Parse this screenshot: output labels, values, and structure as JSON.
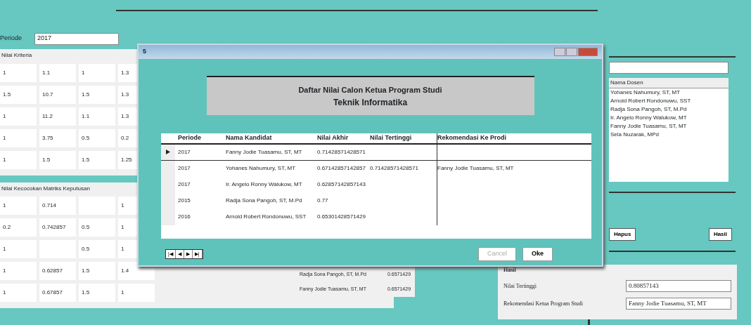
{
  "periode": {
    "label": "Periode",
    "value": "2017"
  },
  "criteria_group": {
    "title": "Nilai Kriteria",
    "rows": [
      [
        "1",
        "1.1",
        "1",
        "1.3"
      ],
      [
        "1.5",
        "10.7",
        "1.5",
        "1.3"
      ],
      [
        "1",
        "11.2",
        "1.1",
        "1.3"
      ],
      [
        "1",
        "3.75",
        "0.5",
        "0.2"
      ],
      [
        "1",
        "1.5",
        "1.5",
        "1.25"
      ]
    ]
  },
  "match_group": {
    "title": "Nilai Kecocokan Matriks Keputusan",
    "rows": [
      [
        "1",
        "0.714",
        "",
        "1"
      ],
      [
        "0.2",
        "0.742857",
        "0.5",
        "1"
      ],
      [
        "1",
        "",
        "0.5",
        "1"
      ],
      [
        "1",
        "0.62857",
        "1.5",
        "1.4"
      ],
      [
        "1",
        "0.67857",
        "1.5",
        "1"
      ]
    ]
  },
  "bottom_rows": [
    {
      "name": "Radja Sona Pangoh, ST, M.Pd",
      "value": "0.6571429"
    },
    {
      "name": "Fanny Jodie Tuasamu, ST, MT",
      "value": "0.6571429"
    }
  ],
  "lecturers": {
    "header": "Nama Dosen",
    "items": [
      "Yohanes Nahumury, ST, MT",
      "Arnold Robert Rondonuwu, SST",
      "Radja Sona Pangoh, ST, M.Pd",
      "Ir. Angelo Ronny Walukow, MT",
      "Fanny Jodie Tuasamu, ST, MT",
      "Sela Nuzarak, MPd"
    ]
  },
  "side_buttons": [
    "Hapus",
    "Hasil"
  ],
  "result": {
    "title": "Hasil",
    "fields": [
      {
        "label": "Nilai Tertinggi",
        "value": "0.80857143"
      },
      {
        "label": "Rekomendasi Ketua Program Studi",
        "value": "Fanny Jodie Tuasamu, ST, MT"
      }
    ]
  },
  "dialog": {
    "icon": "5",
    "title_lines": [
      "Daftar Nilai Calon Ketua Program Studi",
      "Teknik Informatika"
    ],
    "columns": [
      "Periode",
      "Nama Kandidat",
      "Nilai Akhir",
      "Nilai Tertinggi",
      "Rekomendasi Ke Prodi"
    ],
    "rows": [
      {
        "selected": true,
        "cells": [
          "2017",
          "Fanny Jodie Tuasamu, ST, MT",
          "0.71428571428571",
          "",
          ""
        ]
      },
      {
        "selected": false,
        "cells": [
          "2017",
          "Yohanes Nahumury, ST, MT",
          "0.67142857142857",
          "0.71428571428571",
          "Fanny Jodie Tuasamu, ST, MT"
        ]
      },
      {
        "selected": false,
        "cells": [
          "2017",
          "Ir. Angelo Ronny Walukow, MT",
          "0.62857142857143",
          "",
          ""
        ]
      },
      {
        "selected": false,
        "cells": [
          "2015",
          "Radja Sona Pangoh, ST, M.Pd",
          "0.77",
          "",
          ""
        ]
      },
      {
        "selected": false,
        "cells": [
          "2016",
          "Arnold Robert Rondonuwu, SST",
          "0.65301428571429",
          "",
          ""
        ]
      }
    ],
    "nav": [
      "|◀",
      "◀",
      "▶",
      "▶|"
    ],
    "buttons": [
      {
        "label": "Cancel",
        "disabled": true
      },
      {
        "label": "Oke",
        "disabled": false
      }
    ]
  }
}
